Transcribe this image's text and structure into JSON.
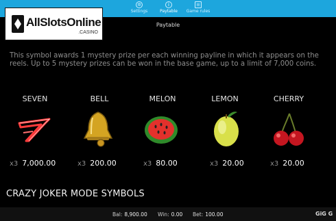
{
  "tabs": [
    {
      "label": "Settings",
      "icon": "gear-icon"
    },
    {
      "label": "Paytable",
      "icon": "info-icon"
    },
    {
      "label": "Game rules",
      "icon": "document-icon"
    }
  ],
  "logo": {
    "name": "AllSlotsOnline",
    "sub": ".CASINO"
  },
  "paytable_title": "Paytable",
  "mystery_text": "This symbol awards 1 mystery prize per each winning payline in which it appears on the reels. Up to 5 mystery prizes can be won in the base game, up to a limit of 7,000 coins.",
  "symbols": [
    {
      "name": "SEVEN",
      "mult": "x3",
      "payout": "7,000.00",
      "icon": "seven-icon"
    },
    {
      "name": "BELL",
      "mult": "x3",
      "payout": "200.00",
      "icon": "bell-icon"
    },
    {
      "name": "MELON",
      "mult": "x3",
      "payout": "80.00",
      "icon": "melon-icon"
    },
    {
      "name": "LEMON",
      "mult": "x3",
      "payout": "20.00",
      "icon": "lemon-icon"
    },
    {
      "name": "CHERRY",
      "mult": "x3",
      "payout": "20.00",
      "icon": "cherry-icon"
    }
  ],
  "section_title": "CRAZY JOKER MODE SYMBOLS",
  "footer": {
    "bal_label": "Bal:",
    "bal_value": "8,900.00",
    "win_label": "Win:",
    "win_value": "0.00",
    "bet_label": "Bet:",
    "bet_value": "100.00",
    "brand": "GiG G"
  },
  "colors": {
    "topbar": "#1da6dd",
    "background": "#000000",
    "footer": "#111111"
  }
}
